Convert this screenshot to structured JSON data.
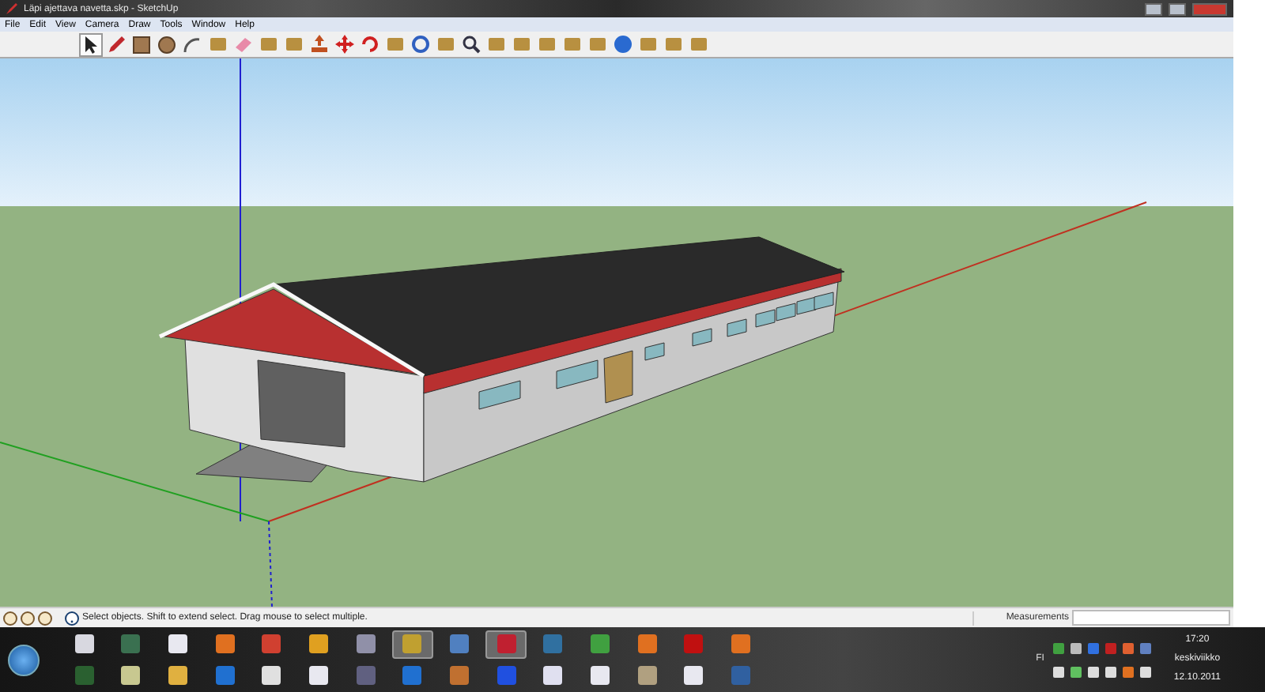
{
  "window": {
    "title": "Läpi ajettava navetta.skp - SketchUp"
  },
  "menu": [
    "File",
    "Edit",
    "View",
    "Camera",
    "Draw",
    "Tools",
    "Window",
    "Help"
  ],
  "tools": [
    {
      "kind": "select",
      "selected": true
    },
    {
      "kind": "pencil",
      "selected": false
    },
    {
      "kind": "rectangle",
      "selected": false
    },
    {
      "kind": "circle",
      "selected": false
    },
    {
      "kind": "arc",
      "selected": false
    },
    {
      "kind": "generic",
      "selected": false
    },
    {
      "kind": "eraser",
      "selected": false
    },
    {
      "kind": "generic",
      "selected": false
    },
    {
      "kind": "generic",
      "selected": false
    },
    {
      "kind": "pushpull",
      "selected": false
    },
    {
      "kind": "move",
      "selected": false
    },
    {
      "kind": "rotate",
      "selected": false
    },
    {
      "kind": "generic",
      "selected": false
    },
    {
      "kind": "orbit",
      "selected": false
    },
    {
      "kind": "generic",
      "selected": false
    },
    {
      "kind": "zoom",
      "selected": false
    },
    {
      "kind": "generic",
      "selected": false
    },
    {
      "kind": "generic",
      "selected": false
    },
    {
      "kind": "generic",
      "selected": false
    },
    {
      "kind": "generic",
      "selected": false
    },
    {
      "kind": "generic",
      "selected": false
    },
    {
      "kind": "globe",
      "selected": false
    },
    {
      "kind": "generic",
      "selected": false
    },
    {
      "kind": "generic",
      "selected": false
    },
    {
      "kind": "generic",
      "selected": false
    }
  ],
  "status_bar": {
    "hint": "Select objects. Shift to extend select. Drag mouse to select multiple.",
    "measurements_label": "Measurements"
  },
  "taskbar": {
    "apps": [
      {
        "active": false
      },
      {
        "active": false
      },
      {
        "active": false
      },
      {
        "active": false
      },
      {
        "active": false
      },
      {
        "active": false
      },
      {
        "active": false
      },
      {
        "active": false
      },
      {
        "active": false
      },
      {
        "active": false
      },
      {
        "active": false
      },
      {
        "active": false
      },
      {
        "active": false
      },
      {
        "active": false
      },
      {
        "active": true
      },
      {
        "active": false
      },
      {
        "active": false
      },
      {
        "active": false
      },
      {
        "active": true
      },
      {
        "active": false
      },
      {
        "active": false
      },
      {
        "active": false
      },
      {
        "active": false
      },
      {
        "active": false
      },
      {
        "active": false
      },
      {
        "active": false
      },
      {
        "active": false
      },
      {
        "active": false
      },
      {
        "active": false
      },
      {
        "active": false
      }
    ],
    "language": "FI",
    "time": "17:20",
    "day": "keskiviikko",
    "date": "12.10.2011"
  }
}
